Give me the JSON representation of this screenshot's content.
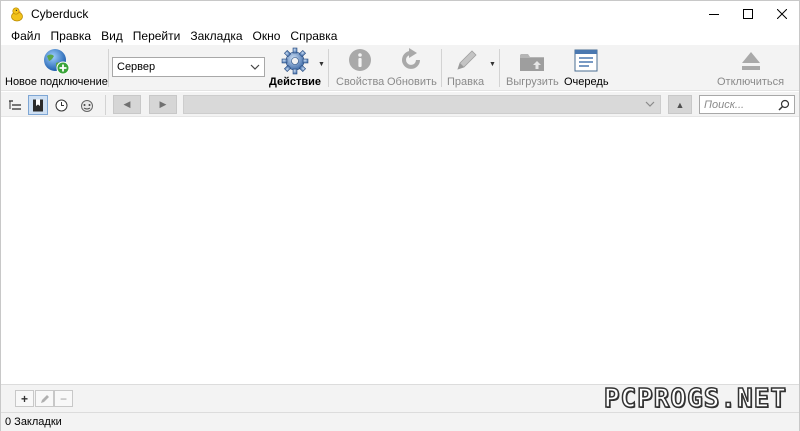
{
  "window": {
    "title": "Cyberduck"
  },
  "menu": [
    "Файл",
    "Правка",
    "Вид",
    "Перейти",
    "Закладка",
    "Окно",
    "Справка"
  ],
  "toolbar": {
    "new_connection": "Новое подключение",
    "server_value": "Сервер",
    "action": "Действие",
    "properties": "Свойства",
    "refresh": "Обновить",
    "edit": "Правка",
    "upload": "Выгрузить",
    "queue": "Очередь",
    "disconnect": "Отключиться"
  },
  "navigation": {
    "search_placeholder": "Поиск..."
  },
  "status": {
    "text": "0 Закладки"
  },
  "watermark": "PCPROGS.NET",
  "colors": {
    "accent": "#2f6db5",
    "toolbar_bg": "#f3f3f3",
    "disabled": "#8a8a8a"
  }
}
